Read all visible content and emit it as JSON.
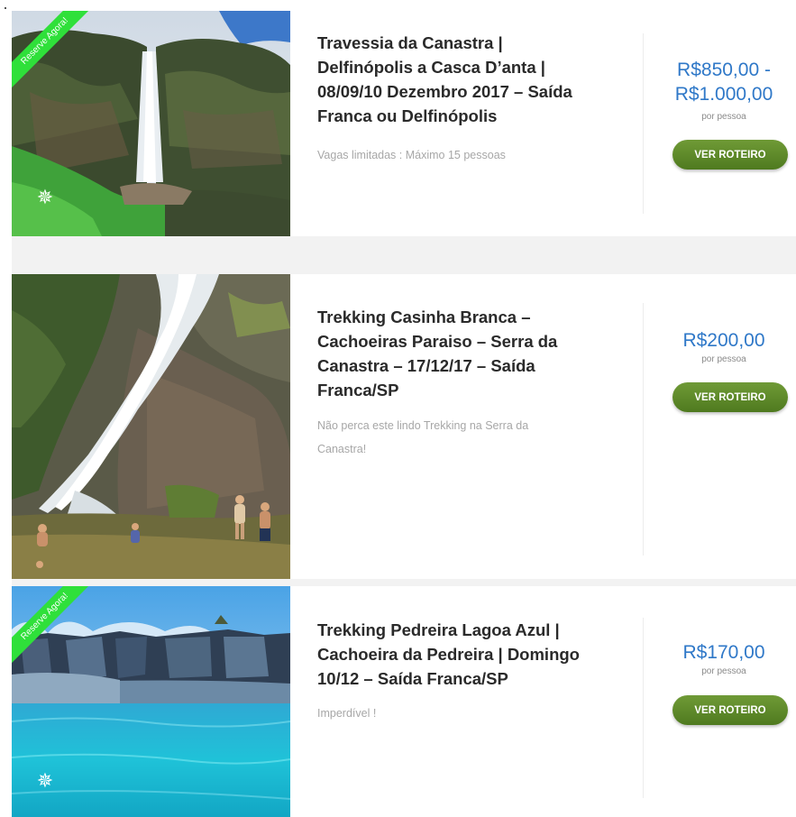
{
  "listings": [
    {
      "ribbon": "Reserve Agora!",
      "title_lines": [
        "Travessia da Canastra |",
        "Delfinópolis a Casca D’anta |",
        "08/09/10 Dezembro 2017 – Saída",
        "Franca ou Delfinópolis"
      ],
      "desc_lines": [
        "Vagas limitadas : Máximo 15 pessoas"
      ],
      "price_lines": [
        "R$850,00 -",
        "R$1.000,00"
      ],
      "per_person": "por pessoa",
      "button": "VER ROTEIRO"
    },
    {
      "title_lines": [
        "Trekking Casinha Branca –",
        "Cachoeiras Paraiso – Serra da",
        "Canastra – 17/12/17 – Saída",
        "Franca/SP"
      ],
      "desc_lines": [
        "Não perca este lindo Trekking na Serra da",
        "Canastra!"
      ],
      "price_lines": [
        "R$200,00"
      ],
      "per_person": "por pessoa",
      "button": "VER ROTEIRO"
    },
    {
      "ribbon": "Reserve Agora!",
      "title_lines": [
        "Trekking Pedreira Lagoa Azul |",
        "Cachoeira da Pedreira | Domingo",
        "10/12 – Saída Franca/SP"
      ],
      "desc_lines": [
        "Imperdível !"
      ],
      "price_lines": [
        "R$170,00"
      ],
      "per_person": "por pessoa",
      "button": "VER ROTEIRO"
    }
  ],
  "icons": {
    "thumbnail_badge": "compass-rose-icon"
  },
  "colors": {
    "price": "#2f78c8",
    "button": "#5b8729",
    "ribbon": "#2fe03a",
    "title": "#2a2a2a",
    "description": "#a7a7a7"
  }
}
